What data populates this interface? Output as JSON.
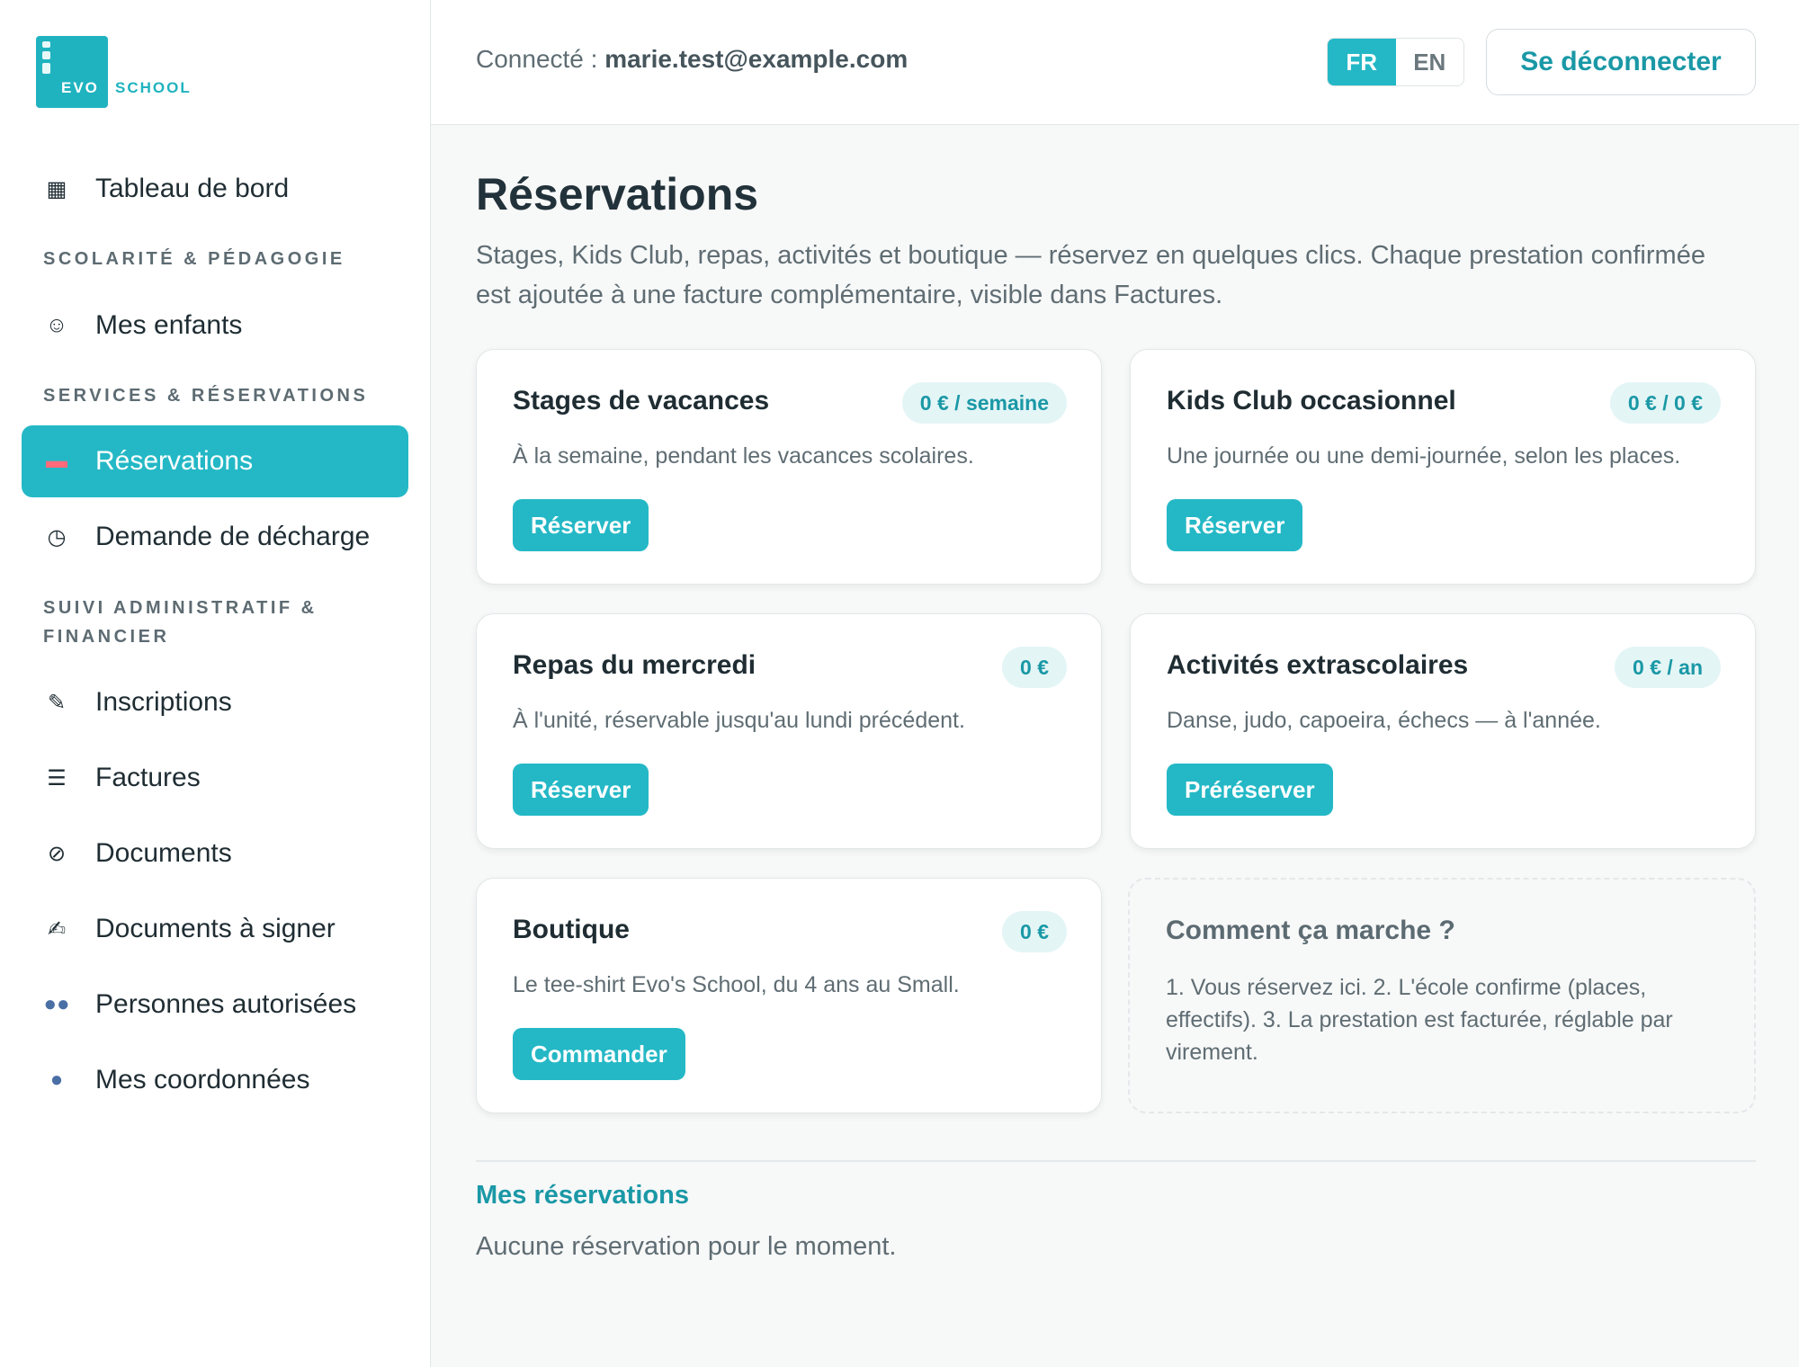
{
  "brand": {
    "logo_evo": "EVO",
    "logo_school": "SCHOOL"
  },
  "sidebar": {
    "items": [
      {
        "label": "Tableau de bord",
        "icon": "grid-icon"
      },
      {
        "section": "SCOLARITÉ & PÉDAGOGIE"
      },
      {
        "label": "Mes enfants",
        "icon": "child-icon"
      },
      {
        "section": "SERVICES & RÉSERVATIONS"
      },
      {
        "label": "Réservations",
        "icon": "ticket-icon",
        "active": true
      },
      {
        "label": "Demande de décharge",
        "icon": "clock-icon"
      },
      {
        "section": "SUIVI ADMINISTRATIF & FINANCIER"
      },
      {
        "label": "Inscriptions",
        "icon": "memo-icon"
      },
      {
        "label": "Factures",
        "icon": "receipt-icon"
      },
      {
        "label": "Documents",
        "icon": "paperclip-icon"
      },
      {
        "label": "Documents à signer",
        "icon": "writing-hand-icon"
      },
      {
        "label": "Personnes autorisées",
        "icon": "people-icon"
      },
      {
        "label": "Mes coordonnées",
        "icon": "person-icon"
      }
    ]
  },
  "header": {
    "connected_label": "Connecté : ",
    "user_email": "marie.test@example.com",
    "lang_fr": "FR",
    "lang_en": "EN",
    "logout_label": "Se déconnecter"
  },
  "page": {
    "title": "Réservations",
    "subtitle": "Stages, Kids Club, repas, activités et boutique — réservez en quelques clics. Chaque prestation confirmée est ajoutée à une facture complémentaire, visible dans Factures."
  },
  "cards": [
    {
      "title": "Stages de vacances",
      "price": "0 € / semaine",
      "desc": "À la semaine, pendant les vacances scolaires.",
      "button": "Réserver"
    },
    {
      "title": "Kids Club occasionnel",
      "price": "0 € / 0 €",
      "desc": "Une journée ou une demi-journée, selon les places.",
      "button": "Réserver"
    },
    {
      "title": "Repas du mercredi",
      "price": "0 €",
      "desc": "À l'unité, réservable jusqu'au lundi précédent.",
      "button": "Réserver"
    },
    {
      "title": "Activités extrascolaires",
      "price": "0 € / an",
      "desc": "Danse, judo, capoeira, échecs — à l'année.",
      "button": "Préréserver"
    },
    {
      "title": "Boutique",
      "price": "0 €",
      "desc": "Le tee-shirt Evo's School, du 4 ans au Small.",
      "button": "Commander"
    }
  ],
  "howto": {
    "title": "Comment ça marche ?",
    "text": "1. Vous réservez ici. 2. L'école confirme (places, effectifs). 3. La prestation est facturée, réglable par virement."
  },
  "my_reservations": {
    "title": "Mes réservations",
    "empty": "Aucune réservation pour le moment."
  },
  "colors": {
    "accent": "#24b8c6",
    "accent_dark": "#1a98a6",
    "price_bg": "#e4f5f6"
  }
}
